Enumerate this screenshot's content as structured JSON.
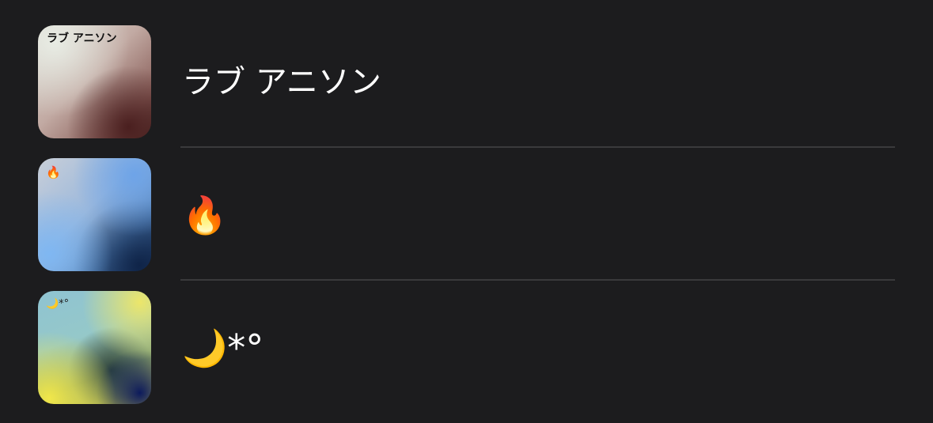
{
  "playlists": [
    {
      "title": "ラブ アニソン",
      "artwork_label": "ラブ アニソン",
      "artwork_colors": [
        "#e8ece4",
        "#c2aaa3",
        "#4f2a27"
      ]
    },
    {
      "title": "🔥",
      "artwork_label": "🔥",
      "artwork_colors": [
        "#c9cfd8",
        "#6ea4e8",
        "#0f2448"
      ]
    },
    {
      "title": "🌙*°",
      "artwork_label": "🌙*°",
      "artwork_colors": [
        "#8fc3d2",
        "#ece66a",
        "#0c1a5c"
      ]
    }
  ],
  "theme": {
    "background": "#1c1c1e",
    "separator": "#3a3a3c",
    "text": "#ffffff"
  }
}
